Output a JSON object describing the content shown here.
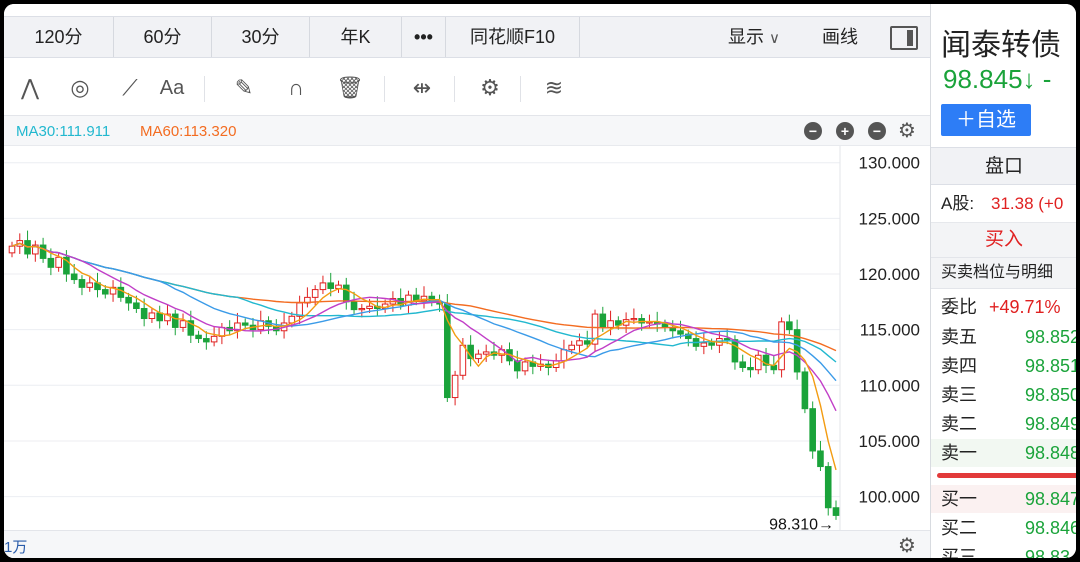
{
  "periods": [
    "120分",
    "60分",
    "30分",
    "年K",
    "•••",
    "同花顺F10"
  ],
  "display_label": "显示",
  "draw_label": "画线",
  "tools": [
    {
      "name": "wave-tool-icon",
      "glyph": "⋀"
    },
    {
      "name": "circle-tool-icon",
      "glyph": "◎"
    },
    {
      "name": "fib-fan-icon",
      "glyph": "⟋"
    },
    {
      "name": "text-tool-icon",
      "glyph": "Aa"
    },
    {
      "name": "eraser-icon",
      "glyph": "✎"
    },
    {
      "name": "magnet-icon",
      "glyph": "∩"
    },
    {
      "name": "trash-icon",
      "glyph": "🗑"
    },
    {
      "name": "split-icon",
      "glyph": "⇹"
    },
    {
      "name": "gear-icon",
      "glyph": "⚙"
    },
    {
      "name": "layers-icon",
      "glyph": "≋"
    }
  ],
  "ma": {
    "ma30": "MA30:111.911",
    "ma60": "MA60:113.320",
    "controls": [
      "⊖",
      "⊕",
      "⊖",
      "⚙"
    ]
  },
  "colors": {
    "up": "#e02020",
    "down": "#1aa33a",
    "ma5": "#f39c12",
    "ma10": "#c13ec7",
    "ma20": "#3b9be8",
    "ma30": "#22b8cf",
    "ma60": "#f36c21"
  },
  "chart_data": {
    "type": "candlestick",
    "y_ticks": [
      "130.000",
      "125.000",
      "120.000",
      "115.000",
      "110.000",
      "105.000",
      "100.000"
    ],
    "ylim": [
      97.0,
      131.5
    ],
    "last_price_label": "98.310→",
    "closes": [
      122.5,
      123.0,
      121.8,
      122.6,
      121.4,
      120.6,
      121.5,
      120.0,
      119.5,
      118.8,
      119.2,
      118.6,
      118.2,
      118.8,
      117.9,
      117.4,
      116.9,
      116.0,
      116.5,
      115.8,
      116.4,
      115.2,
      115.8,
      114.5,
      114.2,
      113.9,
      114.4,
      115.2,
      114.9,
      115.6,
      115.4,
      115.0,
      115.8,
      115.3,
      114.9,
      115.6,
      116.2,
      117.4,
      117.9,
      118.6,
      119.2,
      118.7,
      119.0,
      117.5,
      116.8,
      116.9,
      117.1,
      116.9,
      117.3,
      117.8,
      117.2,
      118.1,
      117.6,
      118.0,
      117.5,
      117.3,
      108.9,
      110.9,
      113.6,
      112.4,
      112.8,
      113.0,
      112.7,
      113.2,
      112.2,
      111.3,
      112.1,
      111.7,
      111.9,
      111.6,
      112.2,
      113.2,
      113.6,
      114.0,
      113.7,
      116.4,
      115.2,
      115.8,
      115.4,
      115.9,
      116.0,
      115.6,
      115.7,
      115.5,
      115.2,
      114.9,
      114.6,
      114.2,
      113.5,
      113.8,
      113.6,
      114.2,
      114.1,
      112.1,
      111.6,
      111.4,
      112.7,
      111.8,
      111.4,
      115.7,
      115.0,
      111.2,
      107.9,
      104.1,
      102.7,
      99.0,
      98.31
    ],
    "annotation": "98.310",
    "volume_label": "1万"
  },
  "panel": {
    "name": "闻泰转债",
    "price": "98.845↓ -",
    "add_watch": "＋自选",
    "title": "盘口",
    "a_share_label": "A股:",
    "a_share_value": "31.38 (+0",
    "buy_label": "买入",
    "detail_label": "买卖档位与明细",
    "ratio_label": "委比",
    "ratio_value": "+49.71%",
    "asks": [
      {
        "label": "卖五",
        "value": "98.852"
      },
      {
        "label": "卖四",
        "value": "98.851"
      },
      {
        "label": "卖三",
        "value": "98.850"
      },
      {
        "label": "卖二",
        "value": "98.849"
      },
      {
        "label": "卖一",
        "value": "98.848"
      }
    ],
    "bids": [
      {
        "label": "买一",
        "value": "98.847"
      },
      {
        "label": "买二",
        "value": "98.846"
      },
      {
        "label": "买三",
        "value": "98.83"
      }
    ]
  }
}
